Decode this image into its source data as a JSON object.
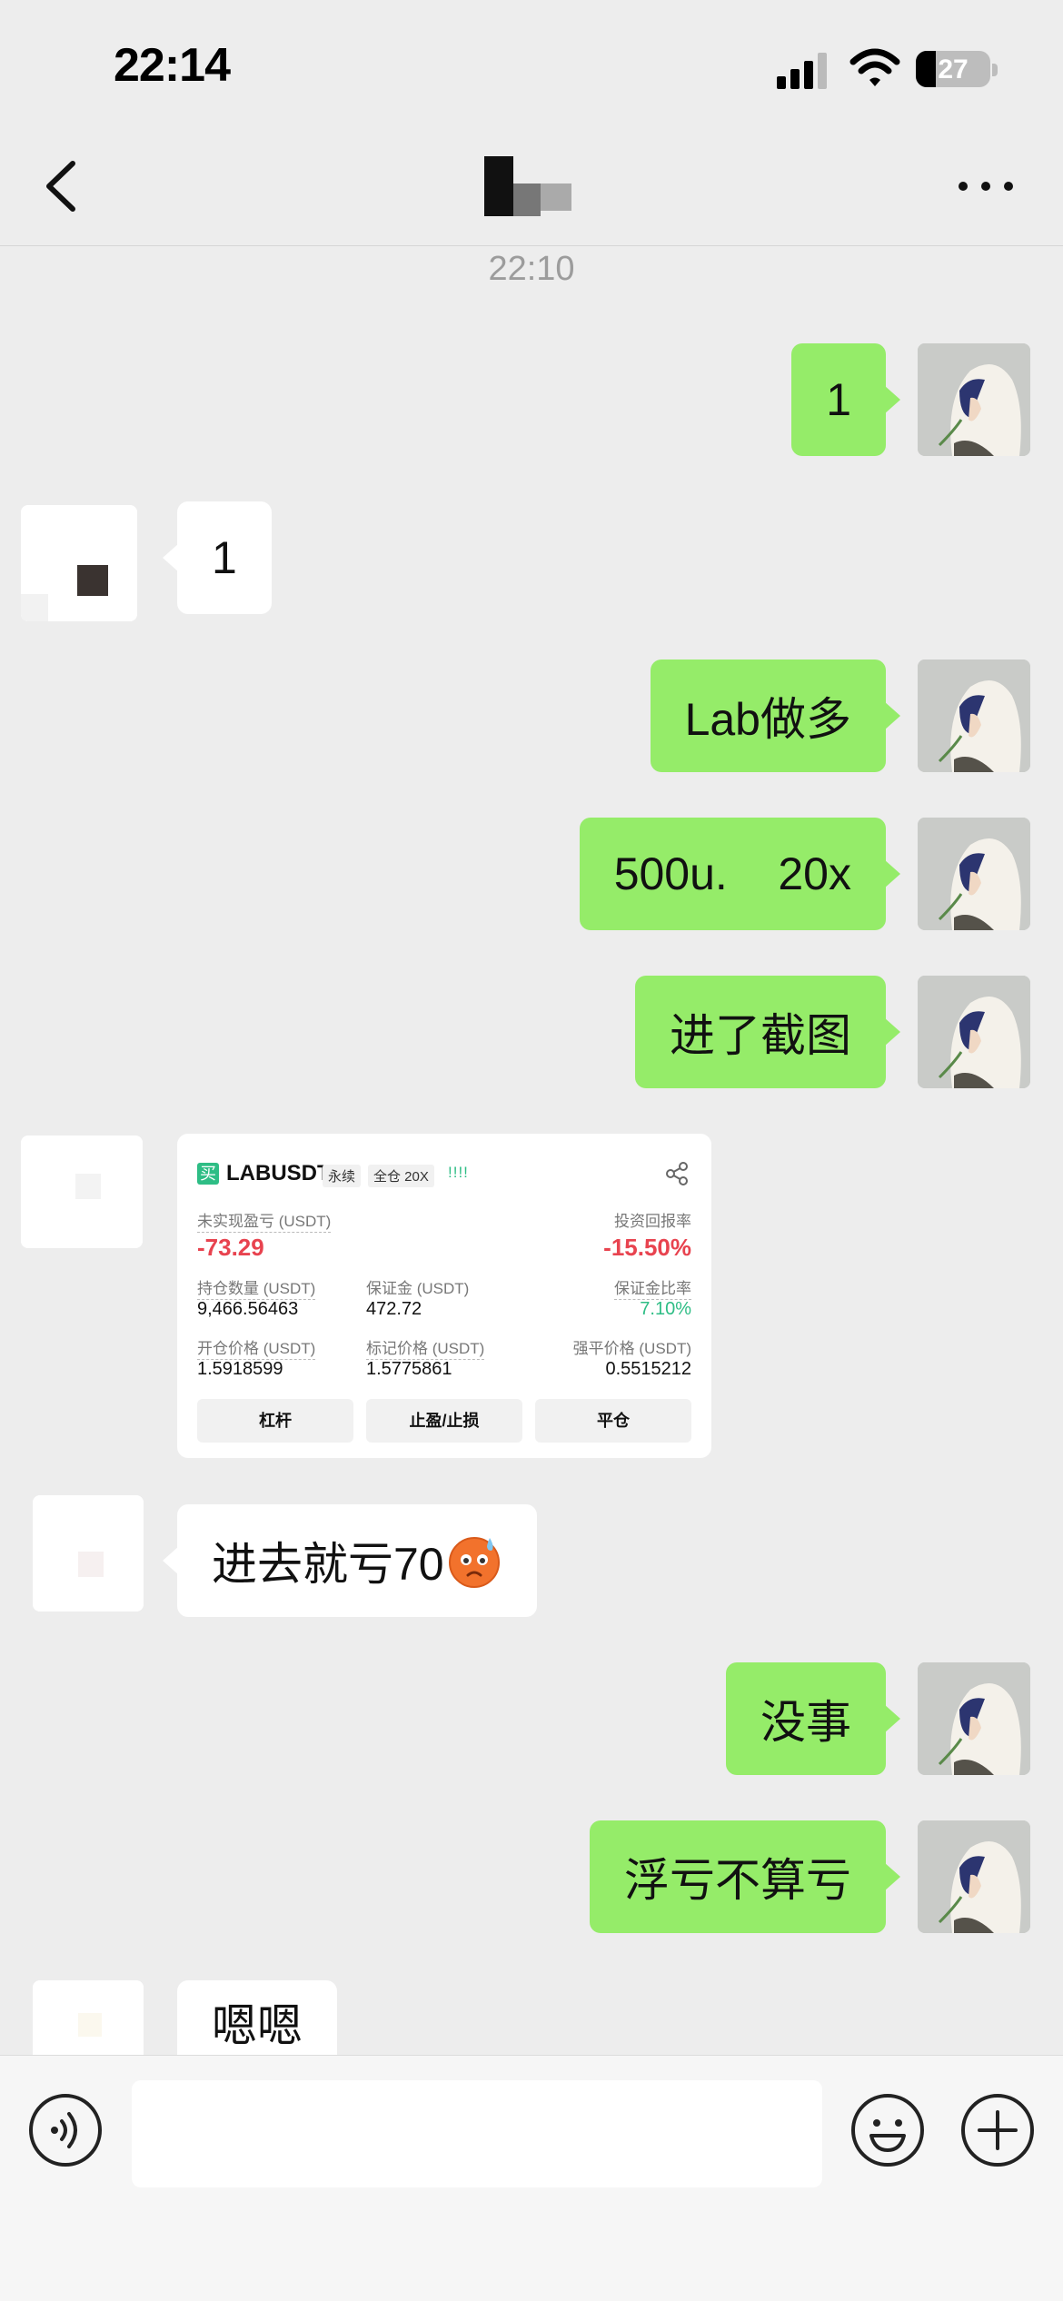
{
  "status_bar": {
    "time": "22:14",
    "battery": "27"
  },
  "chat": {
    "timestamp": "22:10",
    "messages": [
      {
        "side": "self",
        "text": "1"
      },
      {
        "side": "peer",
        "text": "1"
      },
      {
        "side": "self",
        "text": "Lab做多"
      },
      {
        "side": "self",
        "text": "500u.    20x"
      },
      {
        "side": "self",
        "text": "进了截图"
      },
      {
        "side": "peer",
        "type": "image"
      },
      {
        "side": "peer",
        "text": "进去就亏70"
      },
      {
        "side": "self",
        "text": "没事"
      },
      {
        "side": "self",
        "text": "浮亏不算亏"
      },
      {
        "side": "peer",
        "text": "嗯嗯"
      }
    ],
    "trade_card": {
      "buy_badge": "买",
      "symbol": "LABUSDT",
      "tag_perpetual": "永续",
      "tag_margin": "全仓 20X",
      "bars": "!!!!",
      "unrealized_pnl_label": "未实现盈亏 (USDT)",
      "unrealized_pnl_value": "-73.29",
      "roi_label": "投资回报率",
      "roi_value": "-15.50%",
      "position_size_label": "持仓数量 (USDT)",
      "position_size_value": "9,466.56463",
      "margin_label": "保证金 (USDT)",
      "margin_value": "472.72",
      "margin_ratio_label": "保证金比率",
      "margin_ratio_value": "7.10%",
      "entry_price_label": "开仓价格 (USDT)",
      "entry_price_value": "1.5918599",
      "mark_price_label": "标记价格 (USDT)",
      "mark_price_value": "1.5775861",
      "liq_price_label": "强平价格 (USDT)",
      "liq_price_value": "0.5515212",
      "buttons": [
        "杠杆",
        "止盈/止损",
        "平仓"
      ]
    }
  },
  "icons": {
    "back": "chevron-left-icon",
    "more": "more-dots-icon",
    "voice": "voice-icon",
    "emoji": "emoji-icon",
    "plus": "plus-icon",
    "sweat_emoji": "sweat-face-emoji"
  },
  "colors": {
    "self_bubble": "#95ec69",
    "peer_bubble": "#ffffff",
    "background": "#ededed"
  }
}
